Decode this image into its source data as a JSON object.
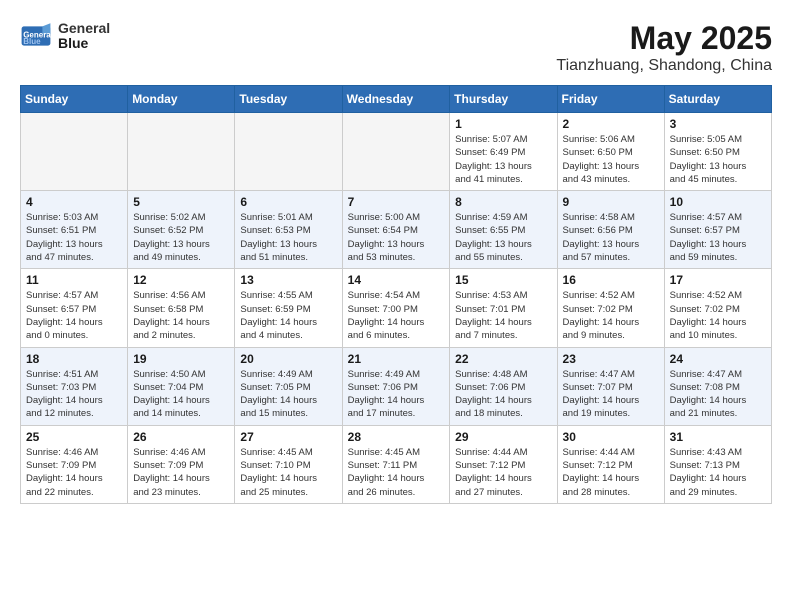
{
  "header": {
    "logo_line1": "General",
    "logo_line2": "Blue",
    "month_year": "May 2025",
    "location": "Tianzhuang, Shandong, China"
  },
  "days_of_week": [
    "Sunday",
    "Monday",
    "Tuesday",
    "Wednesday",
    "Thursday",
    "Friday",
    "Saturday"
  ],
  "weeks": [
    [
      {
        "num": "",
        "info": ""
      },
      {
        "num": "",
        "info": ""
      },
      {
        "num": "",
        "info": ""
      },
      {
        "num": "",
        "info": ""
      },
      {
        "num": "1",
        "info": "Sunrise: 5:07 AM\nSunset: 6:49 PM\nDaylight: 13 hours\nand 41 minutes."
      },
      {
        "num": "2",
        "info": "Sunrise: 5:06 AM\nSunset: 6:50 PM\nDaylight: 13 hours\nand 43 minutes."
      },
      {
        "num": "3",
        "info": "Sunrise: 5:05 AM\nSunset: 6:50 PM\nDaylight: 13 hours\nand 45 minutes."
      }
    ],
    [
      {
        "num": "4",
        "info": "Sunrise: 5:03 AM\nSunset: 6:51 PM\nDaylight: 13 hours\nand 47 minutes."
      },
      {
        "num": "5",
        "info": "Sunrise: 5:02 AM\nSunset: 6:52 PM\nDaylight: 13 hours\nand 49 minutes."
      },
      {
        "num": "6",
        "info": "Sunrise: 5:01 AM\nSunset: 6:53 PM\nDaylight: 13 hours\nand 51 minutes."
      },
      {
        "num": "7",
        "info": "Sunrise: 5:00 AM\nSunset: 6:54 PM\nDaylight: 13 hours\nand 53 minutes."
      },
      {
        "num": "8",
        "info": "Sunrise: 4:59 AM\nSunset: 6:55 PM\nDaylight: 13 hours\nand 55 minutes."
      },
      {
        "num": "9",
        "info": "Sunrise: 4:58 AM\nSunset: 6:56 PM\nDaylight: 13 hours\nand 57 minutes."
      },
      {
        "num": "10",
        "info": "Sunrise: 4:57 AM\nSunset: 6:57 PM\nDaylight: 13 hours\nand 59 minutes."
      }
    ],
    [
      {
        "num": "11",
        "info": "Sunrise: 4:57 AM\nSunset: 6:57 PM\nDaylight: 14 hours\nand 0 minutes."
      },
      {
        "num": "12",
        "info": "Sunrise: 4:56 AM\nSunset: 6:58 PM\nDaylight: 14 hours\nand 2 minutes."
      },
      {
        "num": "13",
        "info": "Sunrise: 4:55 AM\nSunset: 6:59 PM\nDaylight: 14 hours\nand 4 minutes."
      },
      {
        "num": "14",
        "info": "Sunrise: 4:54 AM\nSunset: 7:00 PM\nDaylight: 14 hours\nand 6 minutes."
      },
      {
        "num": "15",
        "info": "Sunrise: 4:53 AM\nSunset: 7:01 PM\nDaylight: 14 hours\nand 7 minutes."
      },
      {
        "num": "16",
        "info": "Sunrise: 4:52 AM\nSunset: 7:02 PM\nDaylight: 14 hours\nand 9 minutes."
      },
      {
        "num": "17",
        "info": "Sunrise: 4:52 AM\nSunset: 7:02 PM\nDaylight: 14 hours\nand 10 minutes."
      }
    ],
    [
      {
        "num": "18",
        "info": "Sunrise: 4:51 AM\nSunset: 7:03 PM\nDaylight: 14 hours\nand 12 minutes."
      },
      {
        "num": "19",
        "info": "Sunrise: 4:50 AM\nSunset: 7:04 PM\nDaylight: 14 hours\nand 14 minutes."
      },
      {
        "num": "20",
        "info": "Sunrise: 4:49 AM\nSunset: 7:05 PM\nDaylight: 14 hours\nand 15 minutes."
      },
      {
        "num": "21",
        "info": "Sunrise: 4:49 AM\nSunset: 7:06 PM\nDaylight: 14 hours\nand 17 minutes."
      },
      {
        "num": "22",
        "info": "Sunrise: 4:48 AM\nSunset: 7:06 PM\nDaylight: 14 hours\nand 18 minutes."
      },
      {
        "num": "23",
        "info": "Sunrise: 4:47 AM\nSunset: 7:07 PM\nDaylight: 14 hours\nand 19 minutes."
      },
      {
        "num": "24",
        "info": "Sunrise: 4:47 AM\nSunset: 7:08 PM\nDaylight: 14 hours\nand 21 minutes."
      }
    ],
    [
      {
        "num": "25",
        "info": "Sunrise: 4:46 AM\nSunset: 7:09 PM\nDaylight: 14 hours\nand 22 minutes."
      },
      {
        "num": "26",
        "info": "Sunrise: 4:46 AM\nSunset: 7:09 PM\nDaylight: 14 hours\nand 23 minutes."
      },
      {
        "num": "27",
        "info": "Sunrise: 4:45 AM\nSunset: 7:10 PM\nDaylight: 14 hours\nand 25 minutes."
      },
      {
        "num": "28",
        "info": "Sunrise: 4:45 AM\nSunset: 7:11 PM\nDaylight: 14 hours\nand 26 minutes."
      },
      {
        "num": "29",
        "info": "Sunrise: 4:44 AM\nSunset: 7:12 PM\nDaylight: 14 hours\nand 27 minutes."
      },
      {
        "num": "30",
        "info": "Sunrise: 4:44 AM\nSunset: 7:12 PM\nDaylight: 14 hours\nand 28 minutes."
      },
      {
        "num": "31",
        "info": "Sunrise: 4:43 AM\nSunset: 7:13 PM\nDaylight: 14 hours\nand 29 minutes."
      }
    ]
  ]
}
